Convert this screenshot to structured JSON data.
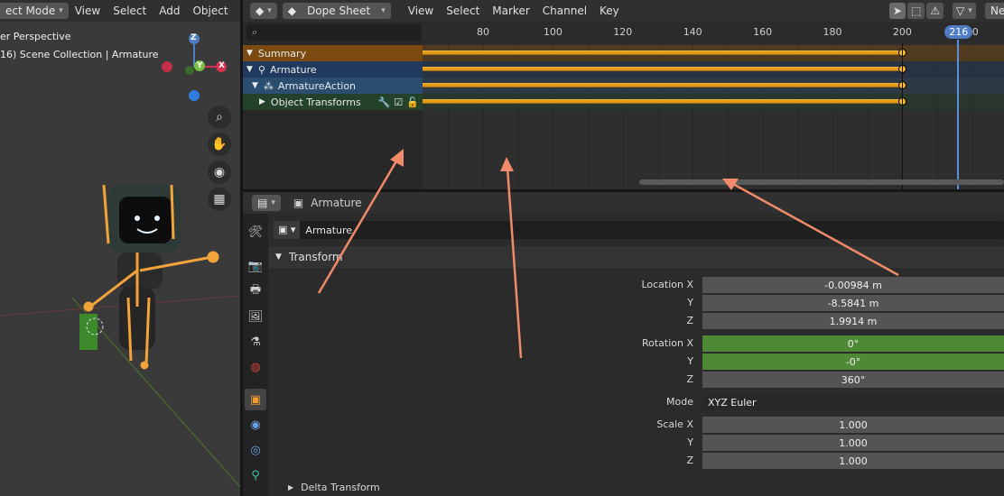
{
  "viewport": {
    "menu": {
      "mode": "ect Mode",
      "view": "View",
      "select": "Select",
      "add": "Add",
      "object": "Object"
    },
    "overlay": {
      "perspective": "er Perspective",
      "collection": "16) Scene Collection | Armature"
    },
    "gizmo": {
      "z": "Z",
      "x": "X",
      "y": "Y"
    }
  },
  "dopesheet": {
    "editor": "Dope Sheet",
    "menu": {
      "view": "View",
      "select": "Select",
      "marker": "Marker",
      "channel": "Channel",
      "key": "Key"
    },
    "header_right": "Ne",
    "channels": [
      {
        "label": "Summary",
        "bg": "#7a4a10"
      },
      {
        "label": "Armature",
        "bg": "#1f3a5e"
      },
      {
        "label": "ArmatureAction",
        "bg": "#2a4d70"
      },
      {
        "label": "Object Transforms",
        "bg": "#24412a"
      }
    ],
    "ruler": [
      "80",
      "100",
      "120",
      "140",
      "160",
      "180",
      "200",
      "20"
    ],
    "current_frame": "216",
    "key_end_frame": 200,
    "bar_start_frame": 64
  },
  "properties": {
    "header_object": "Armature",
    "object_name": "Armature",
    "section": "Transform",
    "sub_section": "Delta Transform",
    "location": {
      "label": "Location X",
      "x": "-0.00984 m",
      "y": "-8.5841 m",
      "z": "1.9914 m"
    },
    "rotation": {
      "label": "Rotation X",
      "x": "0°",
      "y": "-0°",
      "z": "360°"
    },
    "mode": {
      "label": "Mode",
      "value": "XYZ Euler"
    },
    "scale": {
      "label": "Scale X",
      "x": "1.000",
      "y": "1.000",
      "z": "1.000"
    },
    "axis_y": "Y",
    "axis_z": "Z"
  },
  "colors": {
    "accent_green": "#4e8a35",
    "keyframe": "#e09a18",
    "playhead": "#5c8fd6",
    "annotation": "#f08a6a"
  }
}
